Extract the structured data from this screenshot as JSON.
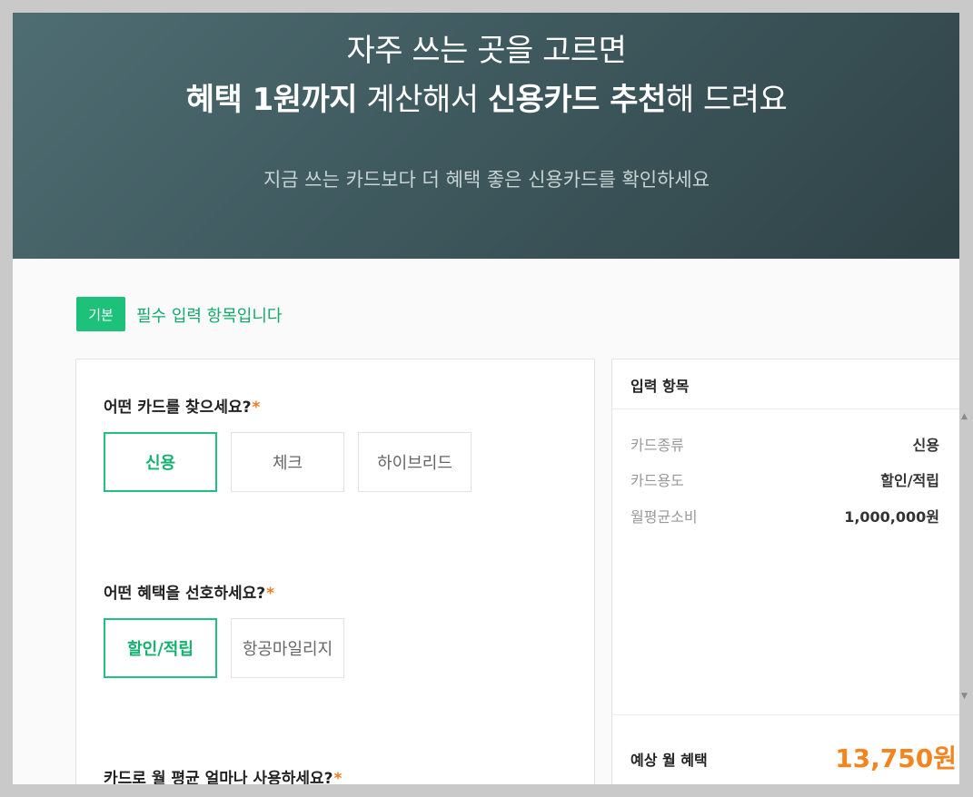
{
  "hero": {
    "line1": "자주 쓰는 곳을 고르면",
    "line2_bold1": "혜택 1원까지",
    "line2_mid": " 계산해서 ",
    "line2_bold2": "신용카드 추천",
    "line2_end": "해 드려요",
    "subtitle": "지금 쓰는 카드보다 더 혜택 좋은 신용카드를 확인하세요"
  },
  "section": {
    "badge": "기본",
    "description": "필수 입력 항목입니다"
  },
  "questions": {
    "card_type": {
      "label": "어떤 카드를 찾으세요?",
      "required_mark": "*",
      "options": [
        "신용",
        "체크",
        "하이브리드"
      ],
      "selected": "신용"
    },
    "benefit": {
      "label": "어떤 혜택을 선호하세요?",
      "required_mark": "*",
      "options": [
        "할인/적립",
        "항공마일리지"
      ],
      "selected": "할인/적립"
    },
    "spending": {
      "label": "카드로 월 평균 얼마나 사용하세요?",
      "required_mark": "*"
    }
  },
  "summary": {
    "title": "입력 항목",
    "rows": [
      {
        "key": "카드종류",
        "value": "신용"
      },
      {
        "key": "카드용도",
        "value": "할인/적립"
      },
      {
        "key": "월평균소비",
        "value": "1,000,000원"
      }
    ],
    "footer_label": "예상 월 혜택",
    "footer_value": "13,750원"
  },
  "scrollbar": {
    "up_icon": "▲",
    "down_icon": "▼"
  }
}
